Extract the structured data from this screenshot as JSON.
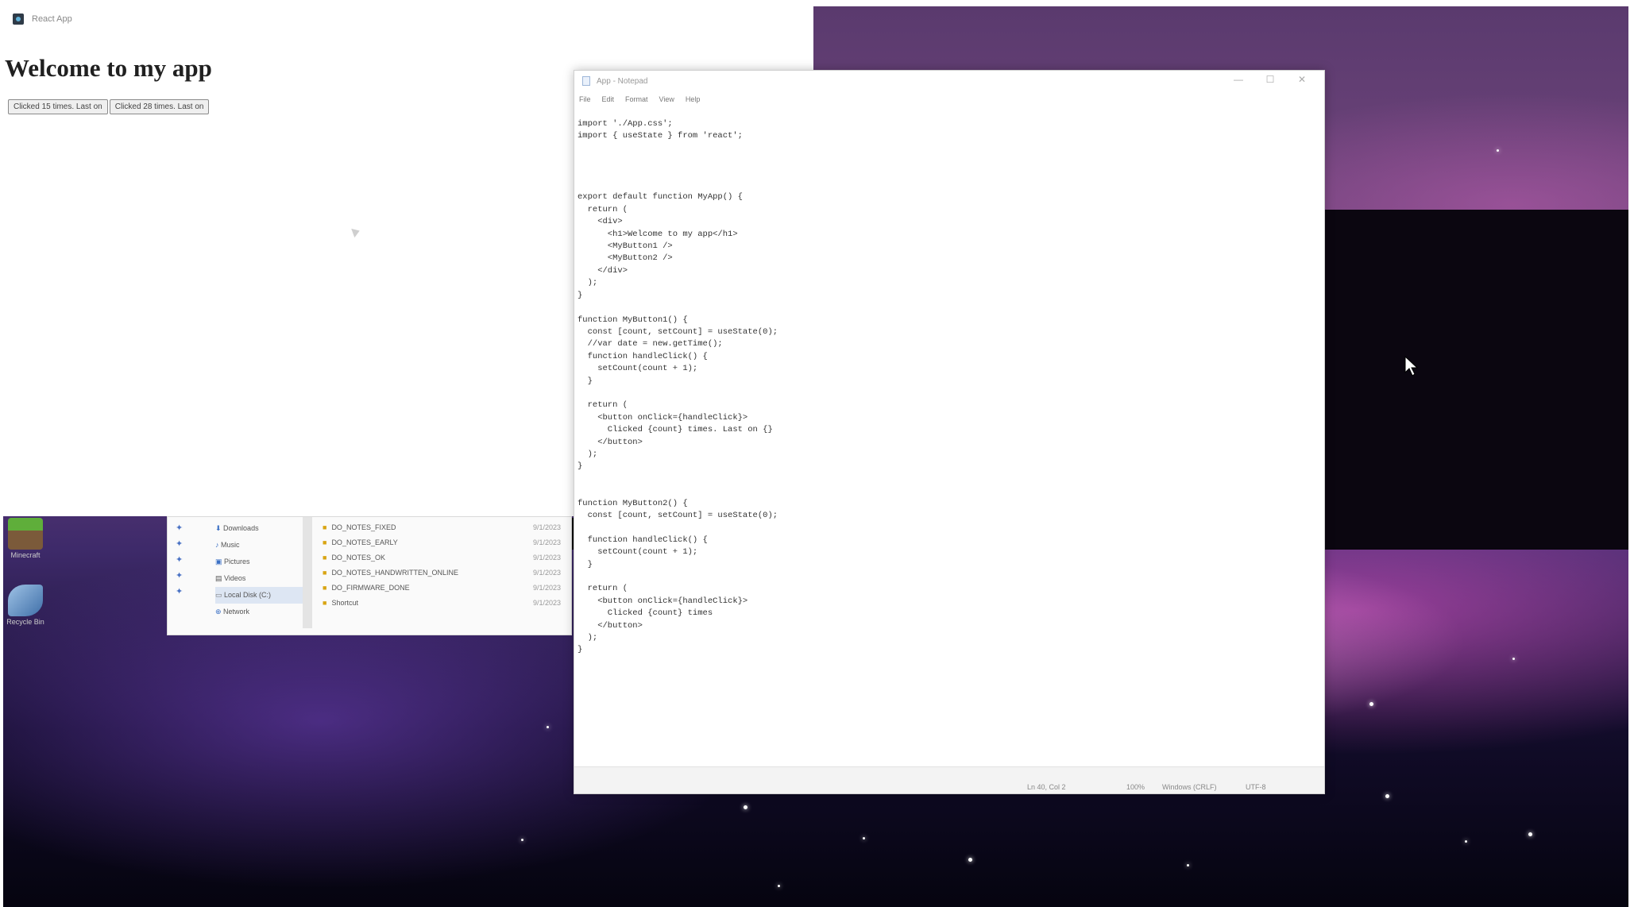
{
  "colors": {
    "wallpaper_top": "#6a4476",
    "wallpaper_bottom": "#05040f",
    "accent_pink": "#d050be",
    "notepad_bg": "#ffffff",
    "folder_yellow": "#d9a514"
  },
  "browser": {
    "tab_title": "React App",
    "favicon": "react-icon",
    "heading": "Welcome to my app",
    "buttons": [
      "Clicked 15 times. Last on",
      "Clicked 28 times. Last on"
    ]
  },
  "notepad": {
    "title": "App - Notepad",
    "menu": [
      "File",
      "Edit",
      "Format",
      "View",
      "Help"
    ],
    "controls": [
      "minimize-icon",
      "maximize-icon",
      "close-icon"
    ],
    "code": "import './App.css';\nimport { useState } from 'react';\n\n\n\n\nexport default function MyApp() {\n  return (\n    <div>\n      <h1>Welcome to my app</h1>\n      <MyButton1 />\n      <MyButton2 />\n    </div>\n  );\n}\n\nfunction MyButton1() {\n  const [count, setCount] = useState(0);\n  //var date = new.getTime();\n  function handleClick() {\n    setCount(count + 1);\n  }\n\n  return (\n    <button onClick={handleClick}>\n      Clicked {count} times. Last on {}\n    </button>\n  );\n}\n\n\nfunction MyButton2() {\n  const [count, setCount] = useState(0);\n\n  function handleClick() {\n    setCount(count + 1);\n  }\n\n  return (\n    <button onClick={handleClick}>\n      Clicked {count} times\n    </button>\n  );\n}",
    "status": {
      "position": "Ln 40, Col 2",
      "zoom": "100%",
      "line_ending": "Windows (CRLF)",
      "encoding": "UTF-8"
    }
  },
  "explorer": {
    "nav_items": [
      "Downloads",
      "Music",
      "Pictures",
      "Videos",
      "Local Disk (C:)",
      "Network"
    ],
    "files": [
      "DO_NOTES_FIXED",
      "DO_NOTES_EARLY",
      "DO_NOTES_OK",
      "DO_NOTES_HANDWRITTEN_ONLINE",
      "DO_FIRMWARE_DONE",
      "Shortcut"
    ],
    "dates": [
      "9/1/2023",
      "9/1/2023",
      "9/1/2023",
      "9/1/2023",
      "9/1/2023",
      "9/1/2023"
    ]
  },
  "desktop": {
    "icons": [
      {
        "label": "Minecraft",
        "icon": "minecraft-icon"
      },
      {
        "label": "Recycle Bin",
        "icon": "shortcut-icon"
      }
    ]
  }
}
